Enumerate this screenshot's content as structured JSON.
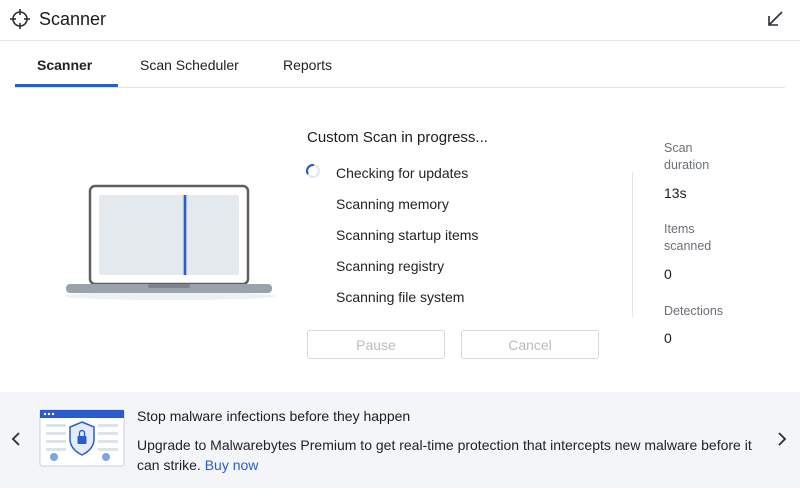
{
  "app": {
    "title": "Scanner",
    "icon": "crosshair-icon"
  },
  "header": {
    "collapse_icon": "arrow-down-left-icon"
  },
  "tabs": [
    {
      "label": "Scanner",
      "active": true
    },
    {
      "label": "Scan Scheduler",
      "active": false
    },
    {
      "label": "Reports",
      "active": false
    }
  ],
  "scan": {
    "title": "Custom Scan in progress...",
    "steps": [
      {
        "label": "Checking for updates",
        "state": "in-progress"
      },
      {
        "label": "Scanning memory",
        "state": "pending"
      },
      {
        "label": "Scanning startup items",
        "state": "pending"
      },
      {
        "label": "Scanning registry",
        "state": "pending"
      },
      {
        "label": "Scanning file system",
        "state": "pending"
      }
    ],
    "pause_label": "Pause",
    "cancel_label": "Cancel"
  },
  "stats": {
    "duration_label_1": "Scan",
    "duration_label_2": "duration",
    "duration_value": "13s",
    "items_label_1": "Items",
    "items_label_2": "scanned",
    "items_value": "0",
    "detections_label": "Detections",
    "detections_value": "0"
  },
  "banner": {
    "title": "Stop malware infections before they happen",
    "body": "Upgrade to Malwarebytes Premium to get real-time protection that intercepts new malware before it can strike.",
    "link": "Buy now",
    "prev_icon": "chevron-left-icon",
    "next_icon": "chevron-right-icon"
  },
  "colors": {
    "accent": "#2b5ccb",
    "banner_bg": "#f3f5f8",
    "divider": "#e1e4e8"
  }
}
